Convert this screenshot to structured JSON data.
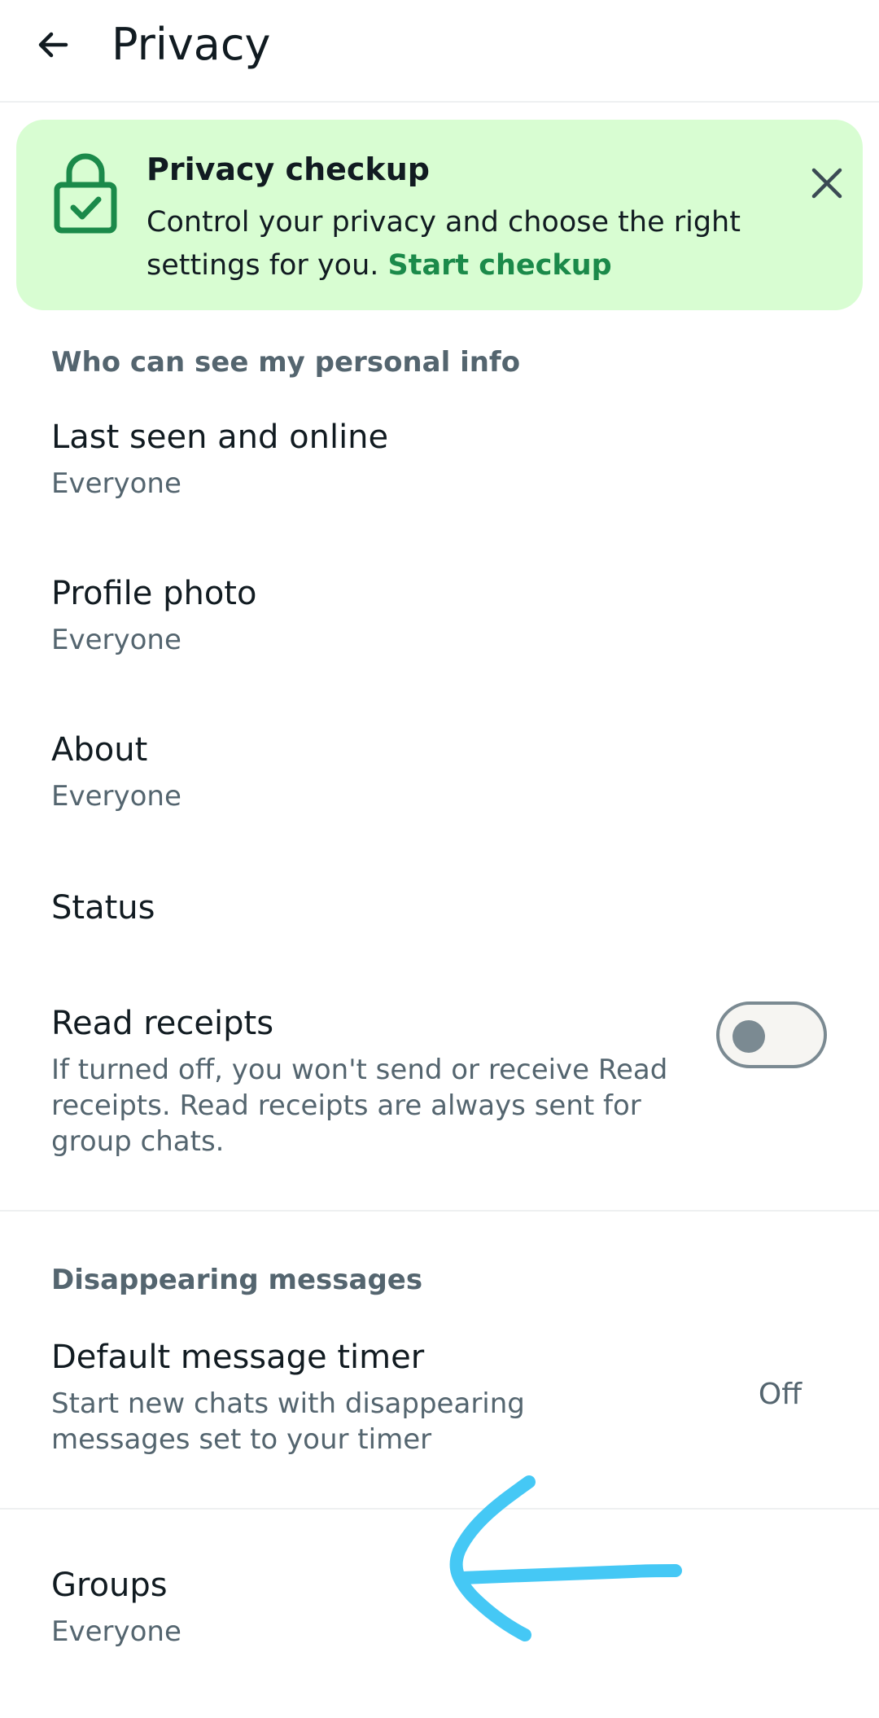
{
  "app_bar": {
    "title": "Privacy",
    "back_icon": "arrow-left-icon"
  },
  "banner": {
    "title": "Privacy checkup",
    "body": "Control your privacy and choose the right settings for you.",
    "link": "Start checkup",
    "lock_icon": "lock-check-icon",
    "close_icon": "close-icon",
    "accent": "#1b8a4a",
    "background": "#d8fdd2"
  },
  "sections": {
    "personal_info": "Who can see my personal info",
    "disappearing": "Disappearing messages"
  },
  "items": {
    "last_seen": {
      "title": "Last seen and online",
      "value": "Everyone"
    },
    "profile_photo": {
      "title": "Profile photo",
      "value": "Everyone"
    },
    "about": {
      "title": "About",
      "value": "Everyone"
    },
    "status": {
      "title": "Status"
    },
    "read_receipts": {
      "title": "Read receipts",
      "description": "If turned off, you won't send or receive Read receipts. Read receipts are always sent for group chats.",
      "enabled": false
    },
    "default_timer": {
      "title": "Default message timer",
      "description": "Start new chats with disappearing messages set to your timer",
      "value": "Off"
    },
    "groups": {
      "title": "Groups",
      "value": "Everyone"
    }
  },
  "annotation": {
    "icon": "hand-drawn-arrow-left-icon",
    "color": "#45c8f5"
  }
}
